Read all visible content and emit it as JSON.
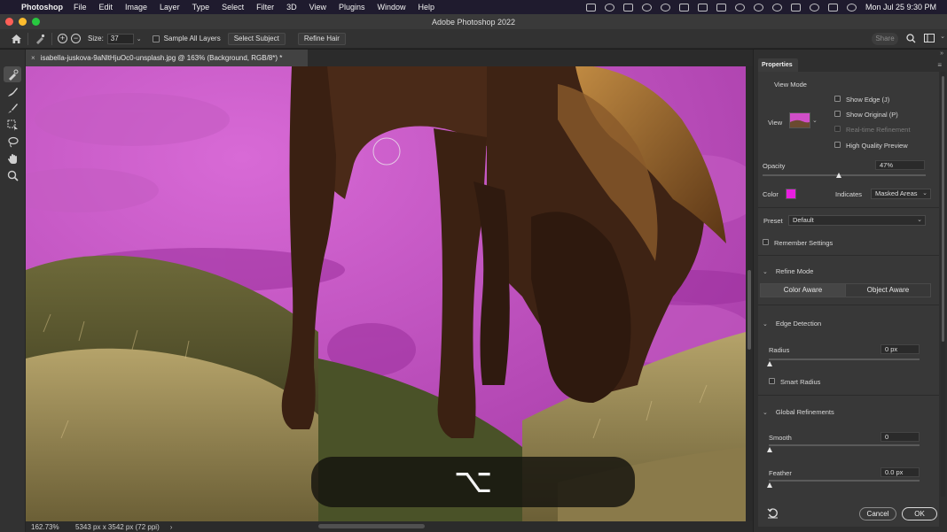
{
  "menubar": {
    "app_name": "Photoshop",
    "items": [
      "File",
      "Edit",
      "Image",
      "Layer",
      "Type",
      "Select",
      "Filter",
      "3D",
      "View",
      "Plugins",
      "Window",
      "Help"
    ],
    "clock": "Mon Jul 25  9:30 PM"
  },
  "window": {
    "title": "Adobe Photoshop 2022"
  },
  "options": {
    "size_label": "Size:",
    "size_value": "37",
    "sample_all_layers": "Sample All Layers",
    "select_subject": "Select Subject",
    "refine_hair": "Refine Hair",
    "share": "Share"
  },
  "document": {
    "tab_title": "isabella-juskova-9aNltHjuOc0-unsplash.jpg @ 163% (Background, RGB/8*) *",
    "zoom": "162.73%",
    "dimensions": "5343 px x 3542 px (72 ppi)",
    "key_hint": "⌥"
  },
  "panel": {
    "tab": "Properties",
    "view_mode": {
      "header": "View Mode",
      "view_label": "View",
      "show_edge": "Show Edge (J)",
      "show_original": "Show Original (P)",
      "realtime_refinement": "Real-time Refinement",
      "high_quality_preview": "High Quality Preview"
    },
    "opacity": {
      "label": "Opacity",
      "value": "47%",
      "level": 0.47
    },
    "color": {
      "label": "Color",
      "swatch": "#e81ee0",
      "indicates_label": "Indicates",
      "indicates_value": "Masked Areas"
    },
    "preset": {
      "label": "Preset",
      "value": "Default"
    },
    "remember_settings": "Remember Settings",
    "refine_mode": {
      "header": "Refine Mode",
      "options": [
        "Color Aware",
        "Object Aware"
      ]
    },
    "edge_detection": {
      "header": "Edge Detection",
      "radius_label": "Radius",
      "radius_value": "0 px",
      "smart_radius": "Smart Radius"
    },
    "global_refinements": {
      "header": "Global Refinements",
      "smooth_label": "Smooth",
      "smooth_value": "0",
      "feather_label": "Feather",
      "feather_value": "0.0 px"
    },
    "cancel": "Cancel",
    "ok": "OK"
  }
}
